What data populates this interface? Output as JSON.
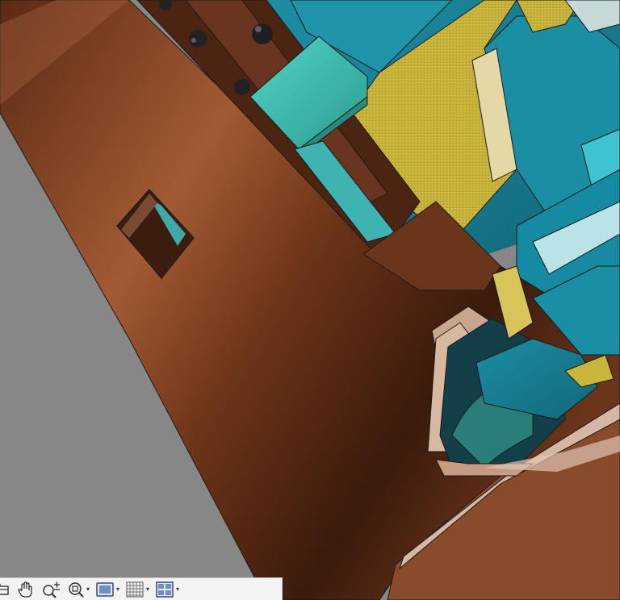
{
  "viewport": {
    "background_color": "#878787",
    "model_colors": {
      "copper": "#8a4a2c",
      "teal": "#1f8fa2",
      "mint": "#3fc3b4",
      "yellow": "#c9b43c",
      "edge": "#1a1a1a"
    }
  },
  "toolbar": {
    "buttons": [
      {
        "name": "view-cube-icon",
        "has_dropdown": false
      },
      {
        "name": "pan-hand-icon",
        "has_dropdown": false
      },
      {
        "name": "zoom-icon",
        "has_dropdown": false
      },
      {
        "name": "zoom-window-icon",
        "has_dropdown": true
      },
      {
        "name": "display-style-icon",
        "has_dropdown": true
      },
      {
        "name": "grid-icon",
        "has_dropdown": true
      },
      {
        "name": "viewports-icon",
        "has_dropdown": true
      }
    ],
    "dropdown_glyph": "▾"
  }
}
